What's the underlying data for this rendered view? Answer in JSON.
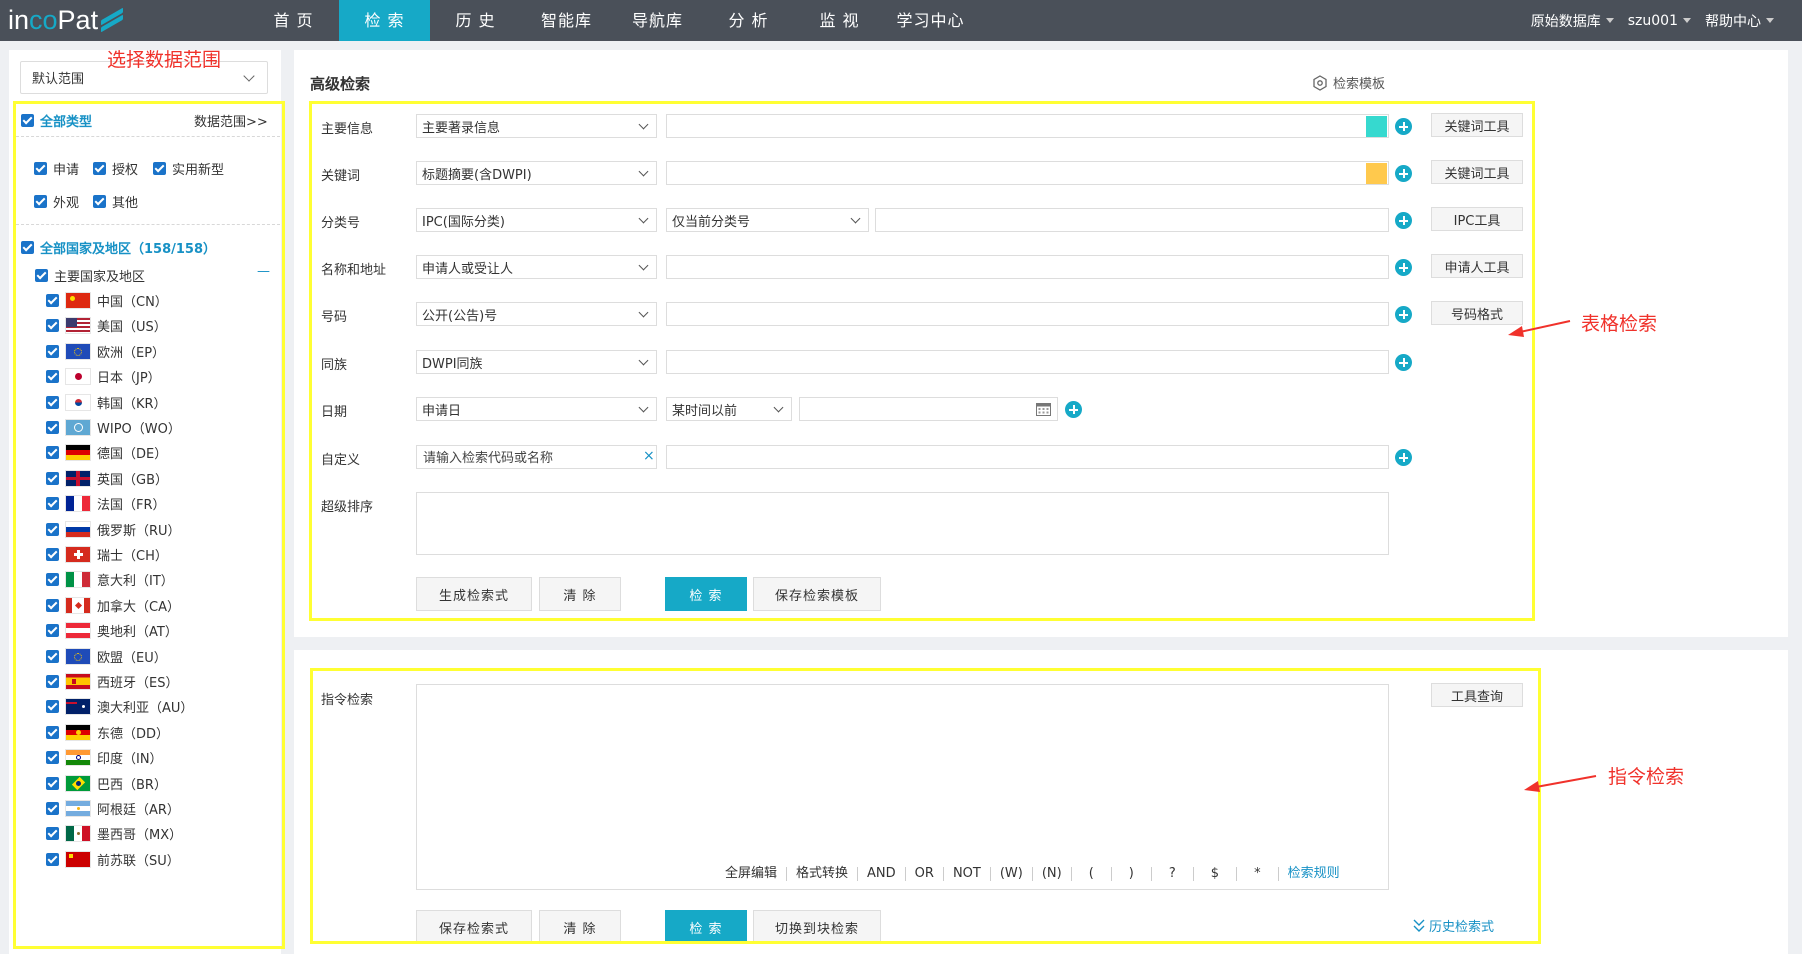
{
  "nav": {
    "logo_part1": "in",
    "logo_part2": "co",
    "logo_part3": "Pat",
    "items": [
      "首 页",
      "检 索",
      "历 史",
      "智能库",
      "导航库",
      "分 析",
      "监 视",
      "学习中心"
    ],
    "right": {
      "db": "原始数据库",
      "user": "szu001",
      "help": "帮助中心"
    }
  },
  "sidebar": {
    "scope_select": "默认范围",
    "annotation": "选择数据范围",
    "all_types": "全部类型",
    "data_range_link": "数据范围>>",
    "types": [
      "申请",
      "授权",
      "实用新型",
      "外观",
      "其他"
    ],
    "all_countries": "全部国家及地区（158/158）",
    "main_countries": "主要国家及地区",
    "collapse": "—",
    "countries": [
      {
        "name": "中国（CN）",
        "flag": "cn"
      },
      {
        "name": "美国（US）",
        "flag": "us"
      },
      {
        "name": "欧洲（EP）",
        "flag": "eu"
      },
      {
        "name": "日本（JP）",
        "flag": "jp"
      },
      {
        "name": "韩国（KR）",
        "flag": "kr"
      },
      {
        "name": "WIPO（WO）",
        "flag": "wo"
      },
      {
        "name": "德国（DE）",
        "flag": "de"
      },
      {
        "name": "英国（GB）",
        "flag": "gb"
      },
      {
        "name": "法国（FR）",
        "flag": "fr"
      },
      {
        "name": "俄罗斯（RU）",
        "flag": "ru"
      },
      {
        "name": "瑞士（CH）",
        "flag": "ch"
      },
      {
        "name": "意大利（IT）",
        "flag": "it"
      },
      {
        "name": "加拿大（CA）",
        "flag": "ca"
      },
      {
        "name": "奥地利（AT）",
        "flag": "at"
      },
      {
        "name": "欧盟（EU）",
        "flag": "eu"
      },
      {
        "name": "西班牙（ES）",
        "flag": "es"
      },
      {
        "name": "澳大利亚（AU）",
        "flag": "au"
      },
      {
        "name": "东德（DD）",
        "flag": "dd"
      },
      {
        "name": "印度（IN）",
        "flag": "in"
      },
      {
        "name": "巴西（BR）",
        "flag": "br"
      },
      {
        "name": "阿根廷（AR）",
        "flag": "ar"
      },
      {
        "name": "墨西哥（MX）",
        "flag": "mx"
      },
      {
        "name": "前苏联（SU）",
        "flag": "su"
      }
    ]
  },
  "advanced": {
    "title": "高级检索",
    "template_link": "检索模板",
    "annotation": "表格检索",
    "rows": {
      "main": {
        "label": "主要信息",
        "select": "主要著录信息",
        "tool": "关键词工具",
        "swatch": "#36d9cf"
      },
      "keyword": {
        "label": "关键词",
        "select": "标题摘要(含DWPI)",
        "tool": "关键词工具",
        "swatch": "#ffc94d"
      },
      "class": {
        "label": "分类号",
        "select": "IPC(国际分类)",
        "select2": "仅当前分类号",
        "tool": "IPC工具"
      },
      "name": {
        "label": "名称和地址",
        "select": "申请人或受让人",
        "tool": "申请人工具"
      },
      "number": {
        "label": "号码",
        "select": "公开(公告)号",
        "tool": "号码格式"
      },
      "family": {
        "label": "同族",
        "select": "DWPI同族"
      },
      "date": {
        "label": "日期",
        "select": "申请日",
        "select2": "某时间以前"
      },
      "custom": {
        "label": "自定义",
        "placeholder": "请输入检索代码或名称",
        "clear": "×"
      },
      "sort": {
        "label": "超级排序"
      }
    },
    "buttons": {
      "generate": "生成检索式",
      "clear": "清 除",
      "search": "检 索",
      "save_template": "保存检索模板"
    }
  },
  "command": {
    "label": "指令检索",
    "tool": "工具查询",
    "annotation": "指令检索",
    "toolbar": [
      "全屏编辑",
      "格式转换",
      "AND",
      "OR",
      "NOT",
      "(W)",
      "(N)",
      "(",
      ")",
      "?",
      "$",
      "*"
    ],
    "rules_link": "检索规则",
    "buttons": {
      "save": "保存检索式",
      "clear": "清 除",
      "search": "检 索",
      "switch": "切换到块检索"
    },
    "history_link": "历史检索式"
  }
}
